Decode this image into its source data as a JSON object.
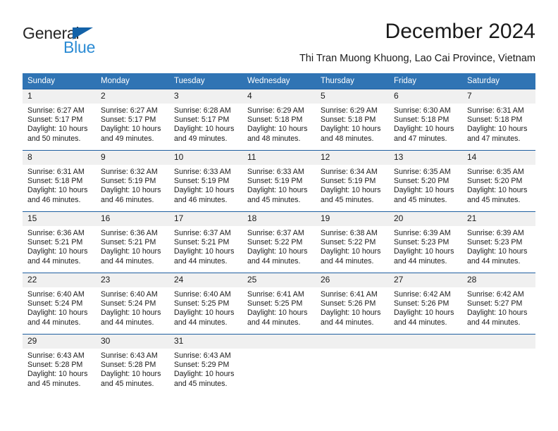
{
  "brand": {
    "name_top": "General",
    "name_bottom": "Blue",
    "triangle_color": "#1362a8",
    "blue_color": "#2b8bd4"
  },
  "header": {
    "title": "December 2024",
    "subtitle": "Thi Tran Muong Khuong, Lao Cai Province, Vietnam"
  },
  "theme": {
    "header_blue": "#3074b4",
    "row_divider": "#1f5fa0",
    "daynum_bg": "#f0f0f0"
  },
  "weekdays": [
    "Sunday",
    "Monday",
    "Tuesday",
    "Wednesday",
    "Thursday",
    "Friday",
    "Saturday"
  ],
  "weeks": [
    [
      {
        "day": "1",
        "sunrise": "Sunrise: 6:27 AM",
        "sunset": "Sunset: 5:17 PM",
        "daylight": "Daylight: 10 hours and 50 minutes."
      },
      {
        "day": "2",
        "sunrise": "Sunrise: 6:27 AM",
        "sunset": "Sunset: 5:17 PM",
        "daylight": "Daylight: 10 hours and 49 minutes."
      },
      {
        "day": "3",
        "sunrise": "Sunrise: 6:28 AM",
        "sunset": "Sunset: 5:17 PM",
        "daylight": "Daylight: 10 hours and 49 minutes."
      },
      {
        "day": "4",
        "sunrise": "Sunrise: 6:29 AM",
        "sunset": "Sunset: 5:18 PM",
        "daylight": "Daylight: 10 hours and 48 minutes."
      },
      {
        "day": "5",
        "sunrise": "Sunrise: 6:29 AM",
        "sunset": "Sunset: 5:18 PM",
        "daylight": "Daylight: 10 hours and 48 minutes."
      },
      {
        "day": "6",
        "sunrise": "Sunrise: 6:30 AM",
        "sunset": "Sunset: 5:18 PM",
        "daylight": "Daylight: 10 hours and 47 minutes."
      },
      {
        "day": "7",
        "sunrise": "Sunrise: 6:31 AM",
        "sunset": "Sunset: 5:18 PM",
        "daylight": "Daylight: 10 hours and 47 minutes."
      }
    ],
    [
      {
        "day": "8",
        "sunrise": "Sunrise: 6:31 AM",
        "sunset": "Sunset: 5:18 PM",
        "daylight": "Daylight: 10 hours and 46 minutes."
      },
      {
        "day": "9",
        "sunrise": "Sunrise: 6:32 AM",
        "sunset": "Sunset: 5:19 PM",
        "daylight": "Daylight: 10 hours and 46 minutes."
      },
      {
        "day": "10",
        "sunrise": "Sunrise: 6:33 AM",
        "sunset": "Sunset: 5:19 PM",
        "daylight": "Daylight: 10 hours and 46 minutes."
      },
      {
        "day": "11",
        "sunrise": "Sunrise: 6:33 AM",
        "sunset": "Sunset: 5:19 PM",
        "daylight": "Daylight: 10 hours and 45 minutes."
      },
      {
        "day": "12",
        "sunrise": "Sunrise: 6:34 AM",
        "sunset": "Sunset: 5:19 PM",
        "daylight": "Daylight: 10 hours and 45 minutes."
      },
      {
        "day": "13",
        "sunrise": "Sunrise: 6:35 AM",
        "sunset": "Sunset: 5:20 PM",
        "daylight": "Daylight: 10 hours and 45 minutes."
      },
      {
        "day": "14",
        "sunrise": "Sunrise: 6:35 AM",
        "sunset": "Sunset: 5:20 PM",
        "daylight": "Daylight: 10 hours and 45 minutes."
      }
    ],
    [
      {
        "day": "15",
        "sunrise": "Sunrise: 6:36 AM",
        "sunset": "Sunset: 5:21 PM",
        "daylight": "Daylight: 10 hours and 44 minutes."
      },
      {
        "day": "16",
        "sunrise": "Sunrise: 6:36 AM",
        "sunset": "Sunset: 5:21 PM",
        "daylight": "Daylight: 10 hours and 44 minutes."
      },
      {
        "day": "17",
        "sunrise": "Sunrise: 6:37 AM",
        "sunset": "Sunset: 5:21 PM",
        "daylight": "Daylight: 10 hours and 44 minutes."
      },
      {
        "day": "18",
        "sunrise": "Sunrise: 6:37 AM",
        "sunset": "Sunset: 5:22 PM",
        "daylight": "Daylight: 10 hours and 44 minutes."
      },
      {
        "day": "19",
        "sunrise": "Sunrise: 6:38 AM",
        "sunset": "Sunset: 5:22 PM",
        "daylight": "Daylight: 10 hours and 44 minutes."
      },
      {
        "day": "20",
        "sunrise": "Sunrise: 6:39 AM",
        "sunset": "Sunset: 5:23 PM",
        "daylight": "Daylight: 10 hours and 44 minutes."
      },
      {
        "day": "21",
        "sunrise": "Sunrise: 6:39 AM",
        "sunset": "Sunset: 5:23 PM",
        "daylight": "Daylight: 10 hours and 44 minutes."
      }
    ],
    [
      {
        "day": "22",
        "sunrise": "Sunrise: 6:40 AM",
        "sunset": "Sunset: 5:24 PM",
        "daylight": "Daylight: 10 hours and 44 minutes."
      },
      {
        "day": "23",
        "sunrise": "Sunrise: 6:40 AM",
        "sunset": "Sunset: 5:24 PM",
        "daylight": "Daylight: 10 hours and 44 minutes."
      },
      {
        "day": "24",
        "sunrise": "Sunrise: 6:40 AM",
        "sunset": "Sunset: 5:25 PM",
        "daylight": "Daylight: 10 hours and 44 minutes."
      },
      {
        "day": "25",
        "sunrise": "Sunrise: 6:41 AM",
        "sunset": "Sunset: 5:25 PM",
        "daylight": "Daylight: 10 hours and 44 minutes."
      },
      {
        "day": "26",
        "sunrise": "Sunrise: 6:41 AM",
        "sunset": "Sunset: 5:26 PM",
        "daylight": "Daylight: 10 hours and 44 minutes."
      },
      {
        "day": "27",
        "sunrise": "Sunrise: 6:42 AM",
        "sunset": "Sunset: 5:26 PM",
        "daylight": "Daylight: 10 hours and 44 minutes."
      },
      {
        "day": "28",
        "sunrise": "Sunrise: 6:42 AM",
        "sunset": "Sunset: 5:27 PM",
        "daylight": "Daylight: 10 hours and 44 minutes."
      }
    ],
    [
      {
        "day": "29",
        "sunrise": "Sunrise: 6:43 AM",
        "sunset": "Sunset: 5:28 PM",
        "daylight": "Daylight: 10 hours and 45 minutes."
      },
      {
        "day": "30",
        "sunrise": "Sunrise: 6:43 AM",
        "sunset": "Sunset: 5:28 PM",
        "daylight": "Daylight: 10 hours and 45 minutes."
      },
      {
        "day": "31",
        "sunrise": "Sunrise: 6:43 AM",
        "sunset": "Sunset: 5:29 PM",
        "daylight": "Daylight: 10 hours and 45 minutes."
      },
      {
        "day": "",
        "sunrise": "",
        "sunset": "",
        "daylight": ""
      },
      {
        "day": "",
        "sunrise": "",
        "sunset": "",
        "daylight": ""
      },
      {
        "day": "",
        "sunrise": "",
        "sunset": "",
        "daylight": ""
      },
      {
        "day": "",
        "sunrise": "",
        "sunset": "",
        "daylight": ""
      }
    ]
  ]
}
